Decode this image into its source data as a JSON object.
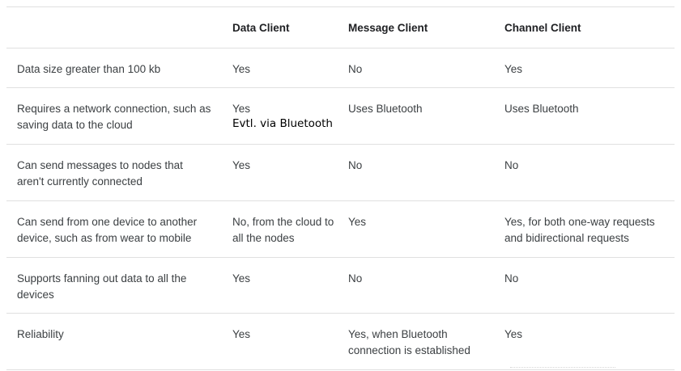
{
  "table": {
    "headers": [
      "",
      "Data Client",
      "Message Client",
      "Channel Client"
    ],
    "rows": [
      {
        "feature": "Data size greater than 100 kb",
        "data_client": "Yes",
        "data_client_note": "",
        "message_client": "No",
        "channel_client": "Yes"
      },
      {
        "feature": "Requires a network connection, such as saving data to the cloud",
        "data_client": "Yes",
        "data_client_note": "Evtl. via Bluetooth",
        "message_client": "Uses Bluetooth",
        "channel_client": "Uses Bluetooth"
      },
      {
        "feature": "Can send messages to nodes that aren't currently connected",
        "data_client": "Yes",
        "data_client_note": "",
        "message_client": "No",
        "channel_client": "No"
      },
      {
        "feature": "Can send from one device to another device, such as from wear to mobile",
        "data_client": "No, from the cloud to all the nodes",
        "data_client_note": "",
        "message_client": "Yes",
        "channel_client": "Yes, for both one-way requests and bidirectional requests"
      },
      {
        "feature": "Supports fanning out data to all the devices",
        "data_client": "Yes",
        "data_client_note": "",
        "message_client": "No",
        "channel_client": "No"
      },
      {
        "feature": "Reliability",
        "data_client": "Yes",
        "data_client_note": "",
        "message_client": "Yes, when Bluetooth connection is established",
        "channel_client": "Yes"
      }
    ]
  }
}
